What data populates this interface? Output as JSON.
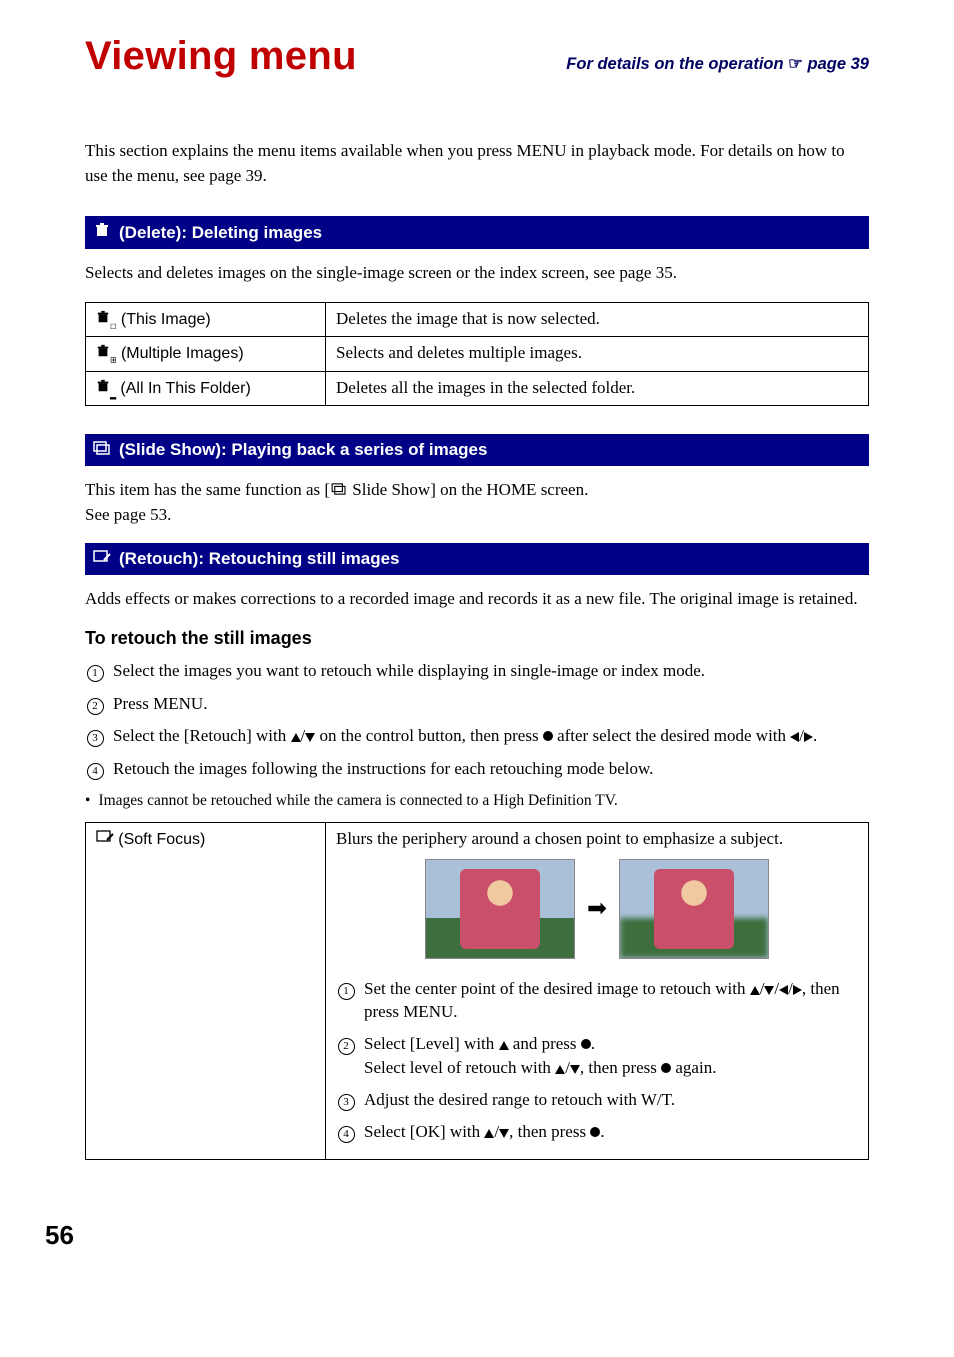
{
  "header": {
    "title": "Viewing menu",
    "ref_prefix": "For details on the operation ",
    "ref_pointer": "☞",
    "ref_page": " page 39"
  },
  "intro": "This section explains the menu items available when you press MENU in playback mode. For details on how to use the menu, see page 39.",
  "delete": {
    "bar": " (Delete): Deleting images",
    "desc": "Selects and deletes images on the single-image screen or the index screen, see page 35.",
    "rows": [
      {
        "label": " (This Image)",
        "desc": "Deletes the image that is now selected."
      },
      {
        "label": " (Multiple Images)",
        "desc": "Selects and deletes multiple images."
      },
      {
        "label": " (All In This Folder)",
        "desc": "Deletes all the images in the selected folder."
      }
    ]
  },
  "slideshow": {
    "bar": " (Slide Show): Playing back a series of images",
    "line1_a": "This item has the same function as [",
    "line1_b": " Slide Show] on the HOME screen.",
    "line2": "See page 53."
  },
  "retouch": {
    "bar": " (Retouch): Retouching still images",
    "desc": "Adds effects or makes corrections to a recorded image and records it as a new file. The original image is retained.",
    "subhead": "To retouch the still images",
    "steps": [
      "Select the images you want to retouch while displaying in single-image or index mode.",
      "Press MENU.",
      "__STEP3__",
      "Retouch the images following the instructions for each retouching mode below."
    ],
    "step3_a": "Select the [Retouch] with ",
    "step3_b": " on the control button, then press ",
    "step3_c": " after select the desired mode with ",
    "step3_d": ".",
    "note": "Images cannot be retouched while the camera is connected to a High Definition TV.",
    "softfocus": {
      "label": " (Soft Focus)",
      "desc": "Blurs the periphery around a chosen point to emphasize a subject.",
      "s1a": "Set the center point of the desired image to retouch with ",
      "s1b": ", then press MENU.",
      "s2a": "Select [Level] with ",
      "s2b": " and press ",
      "s2c": ".",
      "s2d": "Select level of retouch with ",
      "s2e": ", then press ",
      "s2f": " again.",
      "s3": "Adjust the desired range to retouch with W/T.",
      "s4a": "Select [OK] with ",
      "s4b": ", then press ",
      "s4c": "."
    }
  },
  "page_number": "56"
}
